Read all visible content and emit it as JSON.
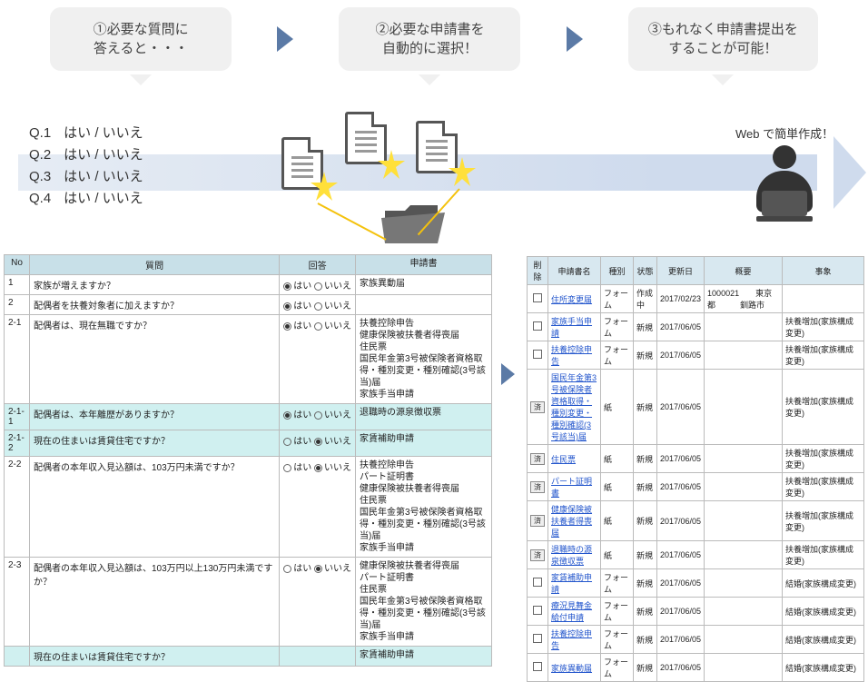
{
  "bubbles": {
    "b1": "①必要な質問に\n答えると・・・",
    "b2": "②必要な申請書を\n自動的に選択！",
    "b3": "③もれなく申請書提出を\nすることが可能！"
  },
  "questions": [
    {
      "num": "Q.1",
      "opts": "はい / いいえ"
    },
    {
      "num": "Q.2",
      "opts": "はい / いいえ"
    },
    {
      "num": "Q.3",
      "opts": "はい / いいえ"
    },
    {
      "num": "Q.4",
      "opts": "はい / いいえ"
    }
  ],
  "user_label": "Web で簡単作成！",
  "left_table": {
    "head": {
      "no": "No",
      "q": "質問",
      "a": "回答",
      "d": "申請書"
    },
    "rows": [
      {
        "no": "1",
        "q": "家族が増えますか？",
        "sel": "y",
        "d": "家族異動届"
      },
      {
        "no": "2",
        "q": "配偶者を扶養対象者に加えますか？",
        "sel": "y",
        "d": ""
      },
      {
        "no": "2-1",
        "q": "配偶者は、現在無職ですか？",
        "sel": "y",
        "d": "扶養控除申告\n健康保険被扶養者得喪届\n住民票\n国民年金第3号被保険者資格取\n得・種別変更・種別確認(3号該\n当)届\n家族手当申請"
      },
      {
        "no": "2-1-1",
        "q": "配偶者は、本年離歴がありますか？",
        "sel": "y",
        "d": "退職時の源泉徴収票",
        "hl": true
      },
      {
        "no": "2-1-2",
        "q": "現在の住まいは賃貸住宅ですか？",
        "sel": "n",
        "d": "家賃補助申請",
        "hl": true
      },
      {
        "no": "2-2",
        "q": "配偶者の本年収入見込額は、103万円未満ですか？",
        "sel": "n",
        "d": "扶養控除申告\nパート証明書\n健康保険被扶養者得喪届\n住民票\n国民年金第3号被保険者資格取\n得・種別変更・種別確認(3号該\n当)届\n家族手当申請"
      },
      {
        "no": "2-3",
        "q": "配偶者の本年収入見込額は、103万円以上130万円未満ですか？",
        "sel": "n",
        "d": "健康保険被扶養者得喪届\nパート証明書\n住民票\n国民年金第3号被保険者資格取\n得・種別変更・種別確認(3号該\n当)届\n家族手当申請"
      },
      {
        "no": "",
        "q": "現在の住まいは賃貸住宅ですか？",
        "sel": "",
        "d": "家賃補助申請",
        "hl": true,
        "partial": true
      }
    ]
  },
  "right_table": {
    "head": {
      "del": "削除",
      "name": "申請書名",
      "kind": "種別",
      "state": "状態",
      "date": "更新日",
      "summary": "概要",
      "event": "事象"
    },
    "rows": [
      {
        "del": "cb",
        "name": "住所変更届",
        "kind": "フォーム",
        "state": "作成中",
        "date": "2017/02/23",
        "summary": "1000021　　東京都　　　釧路市",
        "event": ""
      },
      {
        "del": "cb",
        "name": "家族手当申請",
        "kind": "フォーム",
        "state": "新規",
        "date": "2017/06/05",
        "summary": "",
        "event": "扶養増加(家族構成変更)"
      },
      {
        "del": "cb",
        "name": "扶養控除申告",
        "kind": "フォーム",
        "state": "新規",
        "date": "2017/06/05",
        "summary": "",
        "event": "扶養増加(家族構成変更)"
      },
      {
        "del": "btn",
        "name": "国民年金第3号被保険者資格取得・種別変更・種別確認(3号該当)届",
        "kind": "紙",
        "state": "新規",
        "date": "2017/06/05",
        "summary": "",
        "event": "扶養増加(家族構成変更)"
      },
      {
        "del": "btn",
        "name": "住民票",
        "kind": "紙",
        "state": "新規",
        "date": "2017/06/05",
        "summary": "",
        "event": "扶養増加(家族構成変更)"
      },
      {
        "del": "btn",
        "name": "パート証明書",
        "kind": "紙",
        "state": "新規",
        "date": "2017/06/05",
        "summary": "",
        "event": "扶養増加(家族構成変更)"
      },
      {
        "del": "btn",
        "name": "健康保険被扶養者得喪届",
        "kind": "紙",
        "state": "新規",
        "date": "2017/06/05",
        "summary": "",
        "event": "扶養増加(家族構成変更)"
      },
      {
        "del": "btn",
        "name": "退職時の源泉徴収票",
        "kind": "紙",
        "state": "新規",
        "date": "2017/06/05",
        "summary": "",
        "event": "扶養増加(家族構成変更)"
      },
      {
        "del": "cb",
        "name": "家賃補助申請",
        "kind": "フォーム",
        "state": "新規",
        "date": "2017/06/05",
        "summary": "",
        "event": "結婚(家族構成変更)"
      },
      {
        "del": "cb",
        "name": "療況見舞金給付申請",
        "kind": "フォーム",
        "state": "新規",
        "date": "2017/06/05",
        "summary": "",
        "event": "結婚(家族構成変更)"
      },
      {
        "del": "cb",
        "name": "扶養控除申告",
        "kind": "フォーム",
        "state": "新規",
        "date": "2017/06/05",
        "summary": "",
        "event": "結婚(家族構成変更)"
      },
      {
        "del": "cb",
        "name": "家族異動届",
        "kind": "フォーム",
        "state": "新規",
        "date": "2017/06/05",
        "summary": "",
        "event": "結婚(家族構成変更)"
      }
    ],
    "btn_label": "済"
  }
}
